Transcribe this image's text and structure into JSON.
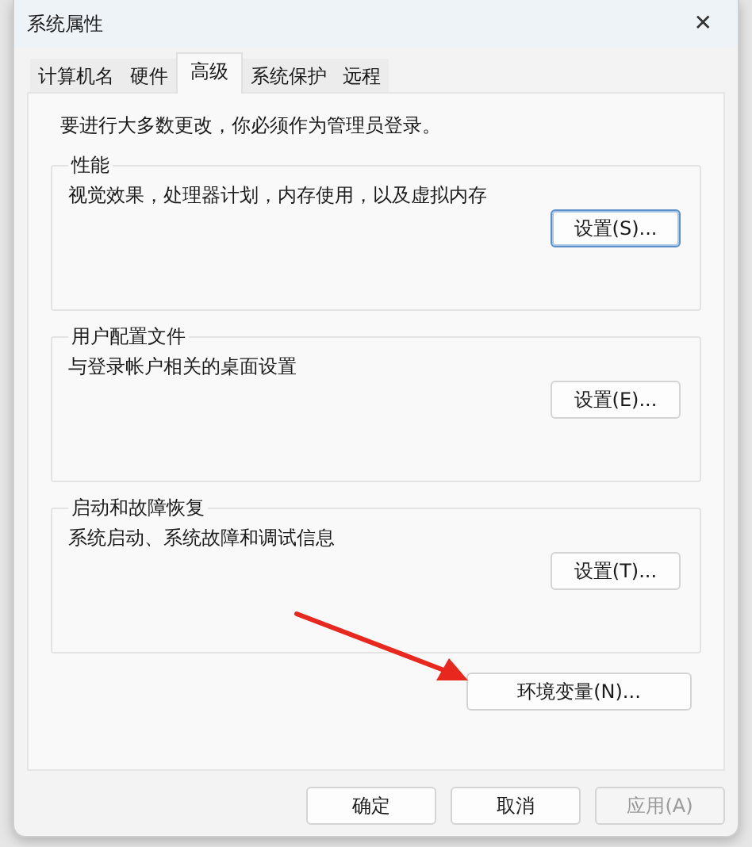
{
  "window": {
    "title": "系统属性",
    "close": "✕"
  },
  "tabs": [
    {
      "label": "计算机名",
      "selected": false
    },
    {
      "label": "硬件",
      "selected": false
    },
    {
      "label": "高级",
      "selected": true
    },
    {
      "label": "系统保护",
      "selected": false
    },
    {
      "label": "远程",
      "selected": false
    }
  ],
  "notice": "要进行大多数更改，你必须作为管理员登录。",
  "groups": [
    {
      "title": "性能",
      "description": "视觉效果，处理器计划，内存使用，以及虚拟内存",
      "button": {
        "label": "设置(S)...",
        "focused": true
      }
    },
    {
      "title": "用户配置文件",
      "description": "与登录帐户相关的桌面设置",
      "button": {
        "label": "设置(E)...",
        "focused": false
      }
    },
    {
      "title": "启动和故障恢复",
      "description": "系统启动、系统故障和调试信息",
      "button": {
        "label": "设置(T)...",
        "focused": false
      }
    }
  ],
  "environment_button": {
    "label": "环境变量(N)..."
  },
  "buttons": [
    {
      "label": "确定",
      "disabled": false
    },
    {
      "label": "取消",
      "disabled": false
    },
    {
      "label": "应用(A)",
      "disabled": true
    }
  ]
}
